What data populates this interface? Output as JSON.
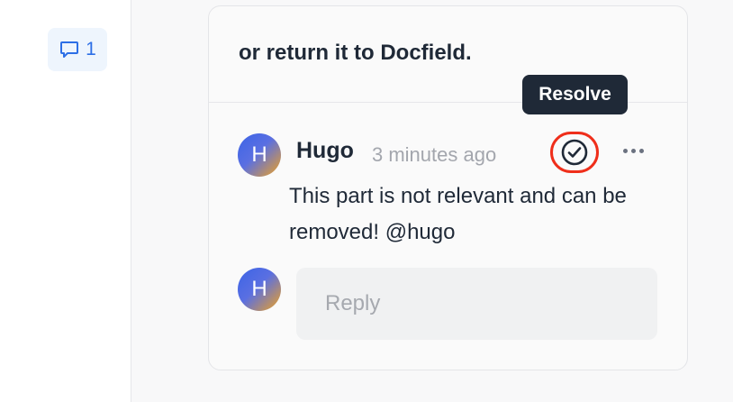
{
  "sidebar": {
    "comment_icon": "speech-bubble-icon",
    "comment_count": "1"
  },
  "comment_card": {
    "quote_text": "or return it to Docfield.",
    "comment": {
      "avatar_initial": "H",
      "author": "Hugo",
      "timestamp": "3 minutes ago",
      "body": "This part is not relevant and can be removed! @hugo",
      "resolve_icon": "check-circle-icon",
      "more_icon": "ellipsis-icon"
    },
    "tooltip": "Resolve",
    "reply": {
      "avatar_initial": "H",
      "placeholder": "Reply"
    }
  },
  "colors": {
    "accent": "#2d6fe6",
    "highlight_ring": "#ef2e1a",
    "tooltip_bg": "#1f2937"
  }
}
